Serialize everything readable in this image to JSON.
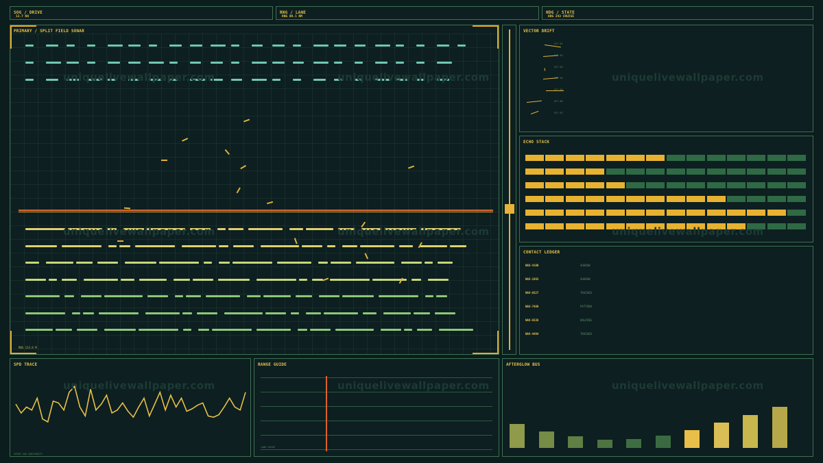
{
  "header": {
    "sog": {
      "title": "SOG / DRIVE",
      "value": "12.7 KN"
    },
    "rng": {
      "title": "RNG / LANE",
      "value": "RNG 09.1 NM"
    },
    "hdg": {
      "title": "HDG / STATE",
      "value": "HDG 243 CRUISE"
    }
  },
  "sonar": {
    "title": "PRIMARY / SPLIT FIELD SONAR",
    "footer": "RNG 124.8 M",
    "top_rows": 3,
    "bottom_rows": 7,
    "colors": {
      "top": "#6fc8b0",
      "bottom_a": "#e0d070",
      "bottom_b": "#8ec878",
      "divider_a": "#e26a2e",
      "divider_b": "#e8b23a"
    }
  },
  "vector_drift": {
    "title": "VECTOR DRIFT",
    "rows": [
      {
        "label": "VCT 01",
        "angle": 8,
        "len": 24
      },
      {
        "label": "VCT 02",
        "angle": -4,
        "len": 22
      },
      {
        "label": "VCT 03",
        "angle": 80,
        "len": 4
      },
      {
        "label": "VCT 04",
        "angle": -5,
        "len": 22
      },
      {
        "label": "VCT 05",
        "angle": 0,
        "len": 26
      },
      {
        "label": "VCT 06",
        "angle": -6,
        "len": 22
      },
      {
        "label": "VCT 07",
        "angle": -20,
        "len": 12
      }
    ]
  },
  "echo_stack": {
    "title": "ECHO STACK",
    "segments": 14,
    "filled": [
      7,
      4,
      5,
      10,
      13,
      11
    ],
    "colors": {
      "on": "#e8b231",
      "off": "#2f6a45"
    }
  },
  "contact_ledger": {
    "title": "CONTACT LEDGER",
    "rows": [
      {
        "id": "NAV-4180",
        "state": "SHADOW"
      },
      {
        "id": "NAV-1893",
        "state": "SHADOW"
      },
      {
        "id": "NAV-9327",
        "state": "TRACKED"
      },
      {
        "id": "NAV-7489",
        "state": "PATTERN"
      },
      {
        "id": "NAV-9336",
        "state": "HOLDING"
      },
      {
        "id": "NAV-4494",
        "state": "TRACKED"
      }
    ]
  },
  "spd_trace": {
    "title": "SPD TRACE",
    "footer": "SPEED VAR CONTINUITY",
    "values": [
      60,
      45,
      55,
      50,
      70,
      35,
      30,
      65,
      62,
      50,
      80,
      90,
      55,
      40,
      85,
      50,
      60,
      75,
      45,
      50,
      62,
      48,
      38,
      55,
      70,
      40,
      60,
      80,
      50,
      75,
      55,
      70,
      48,
      52,
      58,
      62,
      40,
      38,
      42,
      55,
      70,
      55,
      50,
      80
    ],
    "color": "#e8c04a"
  },
  "range_guide": {
    "title": "RANGE GUIDE",
    "footer": "LANE GUIDE",
    "marker": 0.28,
    "marker_color": "#e0602a"
  },
  "afterglow_bus": {
    "title": "AFTERGLOW BUS",
    "bars": [
      {
        "value": 0.58,
        "color": "#8f9a4a"
      },
      {
        "value": 0.4,
        "color": "#748c45"
      },
      {
        "value": 0.28,
        "color": "#5f7f45"
      },
      {
        "value": 0.2,
        "color": "#4e7442"
      },
      {
        "value": 0.22,
        "color": "#3f6d42"
      },
      {
        "value": 0.3,
        "color": "#3b6a42"
      },
      {
        "value": 0.44,
        "color": "#e8bf4a"
      },
      {
        "value": 0.62,
        "color": "#d9bd55"
      },
      {
        "value": 0.8,
        "color": "#c8b84d"
      },
      {
        "value": 1.0,
        "color": "#b6a84a"
      }
    ]
  },
  "watermark": "uniquelivewallpaper.com"
}
